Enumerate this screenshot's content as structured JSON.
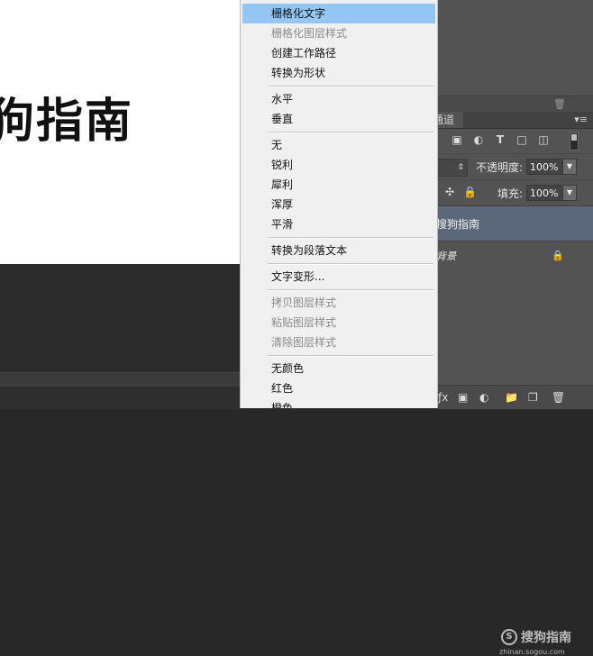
{
  "canvas": {
    "text": "狗指南"
  },
  "context_menu": {
    "items": [
      {
        "label": "栅格化文字",
        "state": "highlighted"
      },
      {
        "label": "栅格化图层样式",
        "state": "disabled"
      },
      {
        "label": "创建工作路径",
        "state": "enabled"
      },
      {
        "label": "转换为形状",
        "state": "enabled"
      },
      {
        "label": "水平",
        "state": "enabled"
      },
      {
        "label": "垂直",
        "state": "enabled"
      },
      {
        "label": "无",
        "state": "enabled"
      },
      {
        "label": "锐利",
        "state": "enabled"
      },
      {
        "label": "犀利",
        "state": "enabled"
      },
      {
        "label": "浑厚",
        "state": "enabled"
      },
      {
        "label": "平滑",
        "state": "enabled"
      },
      {
        "label": "转换为段落文本",
        "state": "enabled"
      },
      {
        "label": "文字变形...",
        "state": "enabled"
      },
      {
        "label": "拷贝图层样式",
        "state": "disabled"
      },
      {
        "label": "粘贴图层样式",
        "state": "disabled"
      },
      {
        "label": "清除图层样式",
        "state": "disabled"
      },
      {
        "label": "无颜色",
        "state": "enabled"
      },
      {
        "label": "红色",
        "state": "enabled"
      },
      {
        "label": "橙色",
        "state": "enabled"
      }
    ]
  },
  "layers_panel": {
    "tab_label": "通道",
    "opacity_label": "不透明度:",
    "opacity_value": "100%",
    "fill_label": "填充:",
    "fill_value": "100%",
    "layers": [
      {
        "name": "搜狗指南",
        "selected": true
      },
      {
        "name": "背景",
        "locked": true
      }
    ]
  },
  "watermark": {
    "logo_letter": "S",
    "name": "搜狗指南",
    "url": "zhinan.sogou.com"
  },
  "colors": {
    "highlight": "#93c6f3",
    "selected_layer": "#5b6879",
    "panel_bg": "#535353",
    "menu_bg": "#f0f0f0"
  }
}
